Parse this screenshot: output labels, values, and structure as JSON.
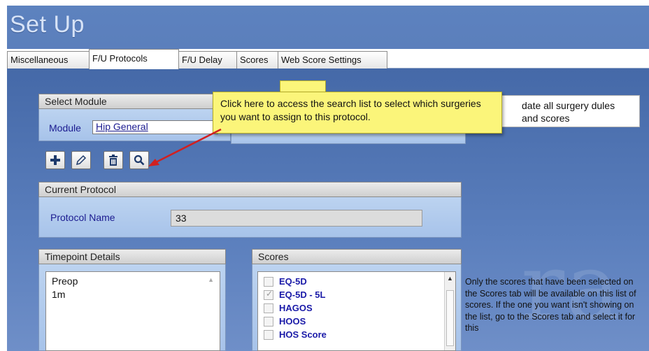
{
  "window": {
    "title": "Set Up"
  },
  "tabs": [
    {
      "label": "Miscellaneous"
    },
    {
      "label": "F/U Protocols"
    },
    {
      "label": "F/U Delay"
    },
    {
      "label": "Scores"
    },
    {
      "label": "Web Score Settings"
    }
  ],
  "select_module": {
    "header": "Select Module",
    "module_label": "Module",
    "module_value": "Hip General"
  },
  "callout": {
    "text": "Click here to access the search list to select which surgeries you want to assign to this protocol."
  },
  "info_box": {
    "text": "date all surgery dules and scores"
  },
  "toolbar": {
    "icons": [
      "plus-icon",
      "pencil-icon",
      "trash-icon",
      "search-icon"
    ]
  },
  "current_protocol": {
    "header": "Current Protocol",
    "name_label": "Protocol Name",
    "name_value": "33"
  },
  "timepoint_details": {
    "header": "Timepoint Details",
    "items": [
      "Preop",
      "1m"
    ]
  },
  "scores": {
    "header": "Scores",
    "items": [
      {
        "label": "EQ-5D",
        "checked": false
      },
      {
        "label": "EQ-5D - 5L",
        "checked": true
      },
      {
        "label": "HAGOS",
        "checked": false
      },
      {
        "label": "HOOS",
        "checked": false
      },
      {
        "label": "HOS Score",
        "checked": false
      }
    ]
  },
  "note": {
    "text": "Only the scores that have been selected on the Scores tab will be available on this list of scores.  If the one you want isn't showing on the list, go to the Scores tab and select it for this"
  },
  "colors": {
    "background": "#5678b4",
    "callout": "#fbf57a",
    "arrow": "#d12020",
    "score_text": "#1a1aa8"
  }
}
